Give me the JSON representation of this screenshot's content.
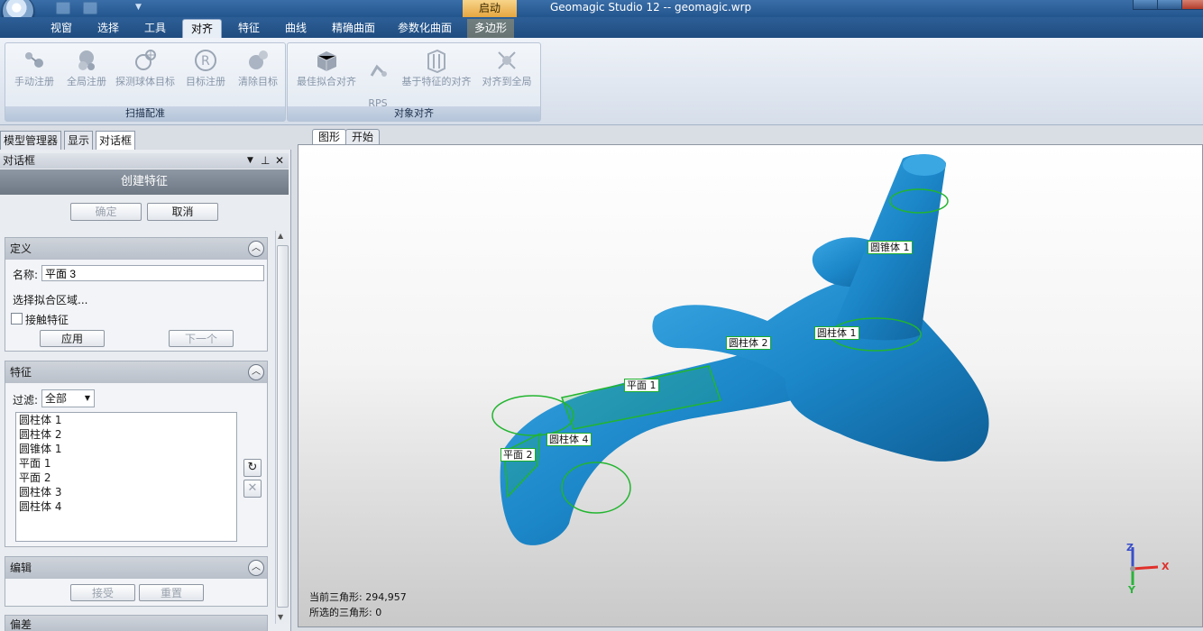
{
  "window": {
    "title": "Geomagic Studio 12 -- geomagic.wrp",
    "context_tab": "启动"
  },
  "ribbon_tabs": [
    "视窗",
    "选择",
    "工具",
    "对齐",
    "特征",
    "曲线",
    "精确曲面",
    "参数化曲面",
    "多边形"
  ],
  "active_tab": "对齐",
  "ribbon": {
    "groups": [
      {
        "label": "扫描配准",
        "buttons": [
          "手动注册",
          "全局注册",
          "探测球体目标",
          "目标注册",
          "清除目标"
        ]
      },
      {
        "label": "对象对齐",
        "buttons": [
          "最佳拟合对齐",
          "RPS\n对齐",
          "基于特征的对齐",
          "对齐到全局"
        ]
      }
    ]
  },
  "left_tabs": [
    "模型管理器",
    "显示",
    "对话框"
  ],
  "dialog": {
    "header": "对话框",
    "title": "创建特征",
    "ok_label": "确定",
    "cancel_label": "取消",
    "definition": {
      "header": "定义",
      "name_label": "名称:",
      "name_value": "平面 3",
      "select_label": "选择拟合区域...",
      "contact_label": "接触特征",
      "apply_label": "应用",
      "next_label": "下一个"
    },
    "features": {
      "header": "特征",
      "filter_label": "过滤:",
      "filter_value": "全部",
      "items": [
        "圆柱体 1",
        "圆柱体 2",
        "圆锥体 1",
        "平面 1",
        "平面 2",
        "圆柱体 3",
        "圆柱体 4"
      ]
    },
    "edit": {
      "header": "编辑",
      "accept_label": "接受",
      "reset_label": "重置"
    },
    "next_section_header": "偏差"
  },
  "viewport_tabs": [
    "图形",
    "开始"
  ],
  "viewport": {
    "feature_labels": [
      "圆锥体 1",
      "圆柱体 1",
      "圆柱体 2",
      "平面 1",
      "圆柱体 4",
      "平面 2"
    ],
    "current_triangles_label": "当前三角形:",
    "current_triangles": "294,957",
    "selected_triangles_label": "所选的三角形:",
    "selected_triangles": "0",
    "axes": {
      "x": "X",
      "y": "Y",
      "z": "Z"
    }
  },
  "colors": {
    "model": "#1f8fd1",
    "feature": "#22b52f",
    "axis_x": "#e0302a",
    "axis_y": "#2bb33a",
    "axis_z": "#3a4fc9"
  }
}
